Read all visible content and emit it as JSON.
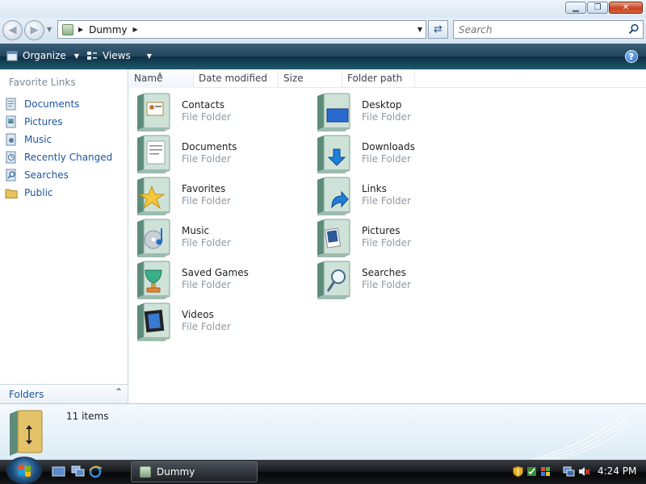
{
  "window": {
    "minimize": "▁",
    "maximize": "❐",
    "close": "✕"
  },
  "address": {
    "folder": "Dummy",
    "search_placeholder": "Search"
  },
  "toolbar": {
    "organize": "Organize",
    "views": "Views",
    "help": "?"
  },
  "nav": {
    "favorites_title": "Favorite Links",
    "items": [
      {
        "label": "Documents",
        "icon": "documents-icon"
      },
      {
        "label": "Pictures",
        "icon": "pictures-icon"
      },
      {
        "label": "Music",
        "icon": "music-icon"
      },
      {
        "label": "Recently Changed",
        "icon": "recently-changed-icon"
      },
      {
        "label": "Searches",
        "icon": "searches-icon"
      },
      {
        "label": "Public",
        "icon": "public-folder-icon"
      }
    ],
    "folders_label": "Folders"
  },
  "columns": {
    "name": "Name",
    "date_modified": "Date modified",
    "size": "Size",
    "folder_path": "Folder path"
  },
  "folders": [
    {
      "name": "Contacts",
      "type": "File Folder",
      "icon": "contacts-folder-icon"
    },
    {
      "name": "Desktop",
      "type": "File Folder",
      "icon": "desktop-folder-icon"
    },
    {
      "name": "Documents",
      "type": "File Folder",
      "icon": "documents-folder-icon"
    },
    {
      "name": "Downloads",
      "type": "File Folder",
      "icon": "downloads-folder-icon"
    },
    {
      "name": "Favorites",
      "type": "File Folder",
      "icon": "favorites-folder-icon"
    },
    {
      "name": "Links",
      "type": "File Folder",
      "icon": "links-folder-icon"
    },
    {
      "name": "Music",
      "type": "File Folder",
      "icon": "music-folder-icon"
    },
    {
      "name": "Pictures",
      "type": "File Folder",
      "icon": "pictures-folder-icon"
    },
    {
      "name": "Saved Games",
      "type": "File Folder",
      "icon": "saved-games-folder-icon"
    },
    {
      "name": "Searches",
      "type": "File Folder",
      "icon": "searches-folder-icon"
    },
    {
      "name": "Videos",
      "type": "File Folder",
      "icon": "videos-folder-icon"
    }
  ],
  "details": {
    "count": "11 items"
  },
  "taskbar": {
    "window_title": "Dummy",
    "clock": "4:24 PM"
  },
  "colors": {
    "link": "#1e57a0",
    "toolbar": "#24465f",
    "muted": "#8e9aa6"
  }
}
